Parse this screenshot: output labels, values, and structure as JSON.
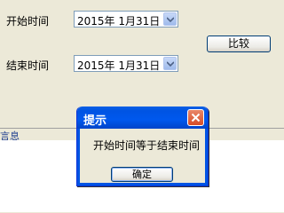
{
  "form": {
    "start_label": "开始时间",
    "start_value": "2015年  1月31日",
    "end_label": "结束时间",
    "end_value": "2015年  1月31日",
    "compare_label": "比较"
  },
  "status": {
    "text": "言息"
  },
  "dialog": {
    "title": "提示",
    "message": "开始时间等于结束时间",
    "ok_label": "确定",
    "close_icon": "close-icon"
  },
  "icons": {
    "dropdown": "chevron-down-icon"
  },
  "colors": {
    "window_bg": "#ece9d8",
    "title_bar": "#0054e3",
    "close_button": "#d94d26"
  }
}
